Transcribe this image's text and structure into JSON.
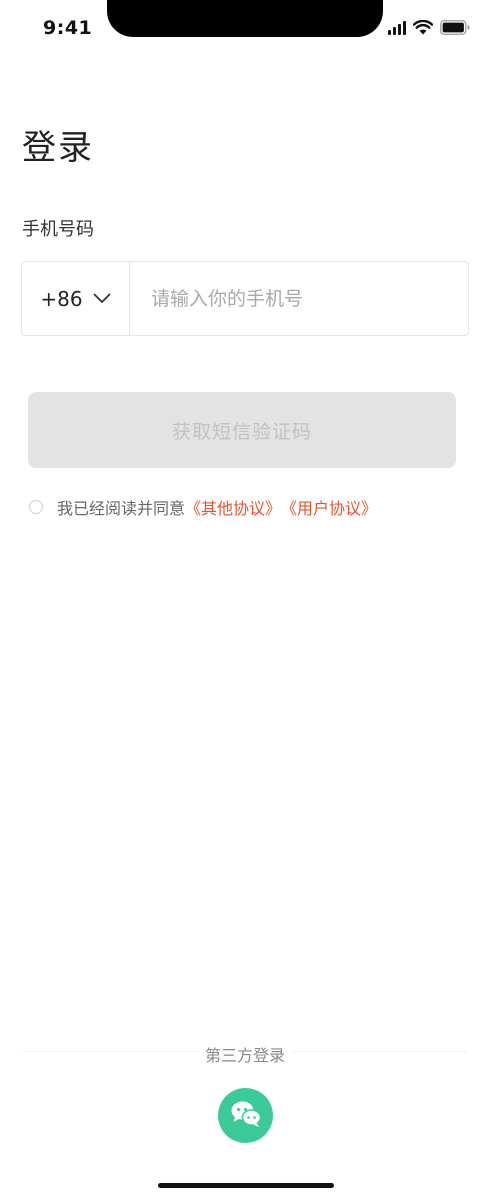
{
  "status_bar": {
    "time": "9:41"
  },
  "page": {
    "title": "登录"
  },
  "phone_field": {
    "label": "手机号码",
    "country_code": "+86",
    "placeholder": "请输入你的手机号"
  },
  "sms_button": {
    "label": "获取短信验证码"
  },
  "agreement": {
    "text": "我已经阅读并同意",
    "link_other": "《其他协议》",
    "link_user": "《用户协议》"
  },
  "third_party": {
    "label": "第三方登录"
  },
  "colors": {
    "accent": "#e8532e",
    "wechat": "#3ccb98",
    "disabled_button": "#e3e3e3"
  },
  "icons": [
    "signal-icon",
    "wifi-icon",
    "battery-icon",
    "chevron-down-icon",
    "wechat-icon"
  ]
}
